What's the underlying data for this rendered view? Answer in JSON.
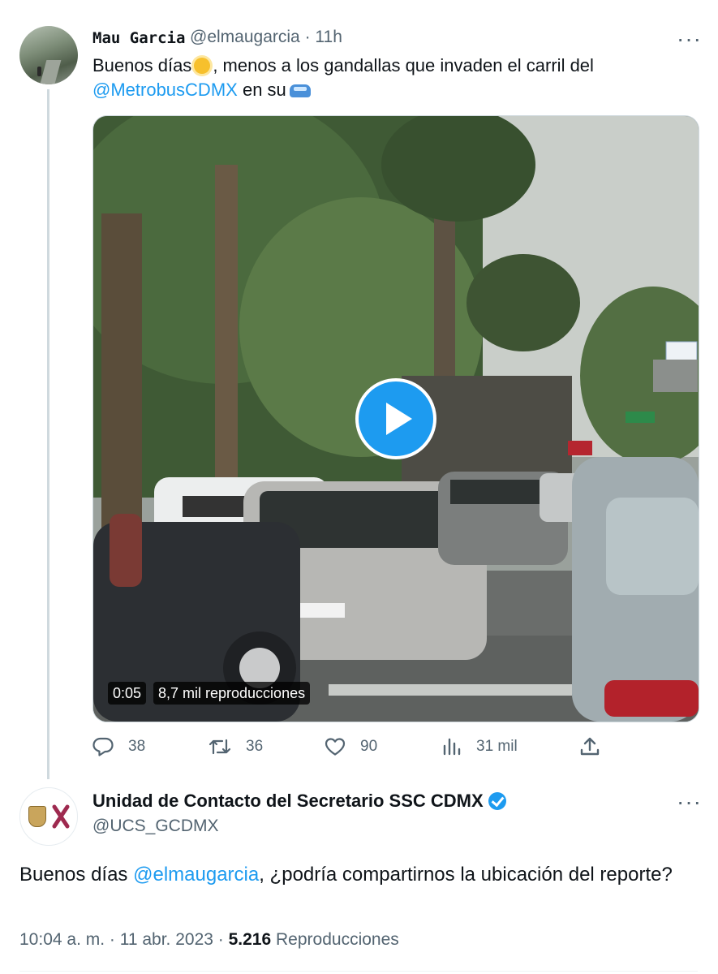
{
  "tweet": {
    "display_name": "Mau Garcia",
    "handle": "@elmaugarcia",
    "separator": "·",
    "time": "11h",
    "text_part1": "Buenos días",
    "text_part2": ", menos a los gandallas que invaden el carril del",
    "mention": "@MetrobusCDMX",
    "text_part3": "en su",
    "video": {
      "duration": "0:05",
      "views": "8,7 mil reproducciones"
    },
    "actions": {
      "replies": "38",
      "retweets": "36",
      "likes": "90",
      "views": "31 mil"
    }
  },
  "reply": {
    "display_name": "Unidad de Contacto del Secretario SSC CDMX",
    "handle": "@UCS_GCDMX",
    "text_part1": "Buenos días",
    "mention": "@elmaugarcia",
    "text_part2": ", ¿podría compartirnos la ubicación del reporte?",
    "timestamp": "10:04 a. m. · 11 abr. 2023 ·",
    "views_count": "5.216",
    "views_label": "Reproducciones"
  },
  "colors": {
    "accent": "#1d9bf0",
    "text": "#0f1419",
    "secondary": "#536471"
  }
}
